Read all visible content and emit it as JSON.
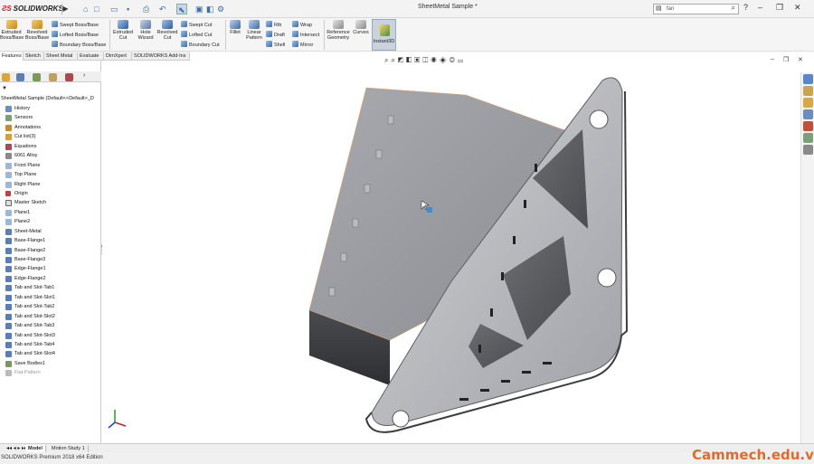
{
  "app": {
    "logo": "SOLIDWORKS",
    "doc_title": "SheetMetal Sample *",
    "search_placeholder": "fan"
  },
  "ribbon": {
    "large": [
      {
        "label": "Extruded Boss/Base"
      },
      {
        "label": "Revolved Boss/Base"
      },
      {
        "label": "Extruded Cut"
      },
      {
        "label": "Hole Wizard"
      },
      {
        "label": "Revolved Cut"
      },
      {
        "label": "Fillet"
      },
      {
        "label": "Linear Pattern"
      },
      {
        "label": "Reference Geometry"
      },
      {
        "label": "Curves"
      }
    ],
    "small": [
      {
        "label": "Swept Boss/Base"
      },
      {
        "label": "Lofted Boss/Base"
      },
      {
        "label": "Boundary Boss/Base"
      },
      {
        "label": "Swept Cut"
      },
      {
        "label": "Lofted Cut"
      },
      {
        "label": "Boundary Cut"
      },
      {
        "label": "Rib"
      },
      {
        "label": "Draft"
      },
      {
        "label": "Shell"
      },
      {
        "label": "Wrap"
      },
      {
        "label": "Intersect"
      },
      {
        "label": "Mirror"
      }
    ],
    "instant3d": "Instant3D"
  },
  "tabs": [
    "Features",
    "Sketch",
    "Sheet Metal",
    "Evaluate",
    "DimXpert",
    "SOLIDWORKS Add-Ins"
  ],
  "tree": {
    "root": "SheetMetal Sample  (Default<<Default>_D",
    "items": [
      "History",
      "Sensors",
      "Annotations",
      "Cut list(3)",
      "Equations",
      "6061 Alloy",
      "Front Plane",
      "Top Plane",
      "Right Plane",
      "Origin",
      "Master Sketch",
      "Plane1",
      "Plane2",
      "Sheet-Metal",
      "Base-Flange1",
      "Base-Flange2",
      "Base-Flange3",
      "Edge-Flange1",
      "Edge-Flange2",
      "Tab and Slot-Tab1",
      "Tab and Slot-Slot1",
      "Tab and Slot-Tab2",
      "Tab and Slot-Slot2",
      "Tab and Slot-Tab3",
      "Tab and Slot-Slot3",
      "Tab and Slot-Tab4",
      "Tab and Slot-Slot4",
      "Save Bodies1",
      "Flat-Pattern"
    ]
  },
  "bottom_tabs": [
    "Model",
    "Motion Study 1"
  ],
  "status": "SOLIDWORKS Premium 2018 x64 Edition",
  "watermark": "Cammech.edu.vn"
}
